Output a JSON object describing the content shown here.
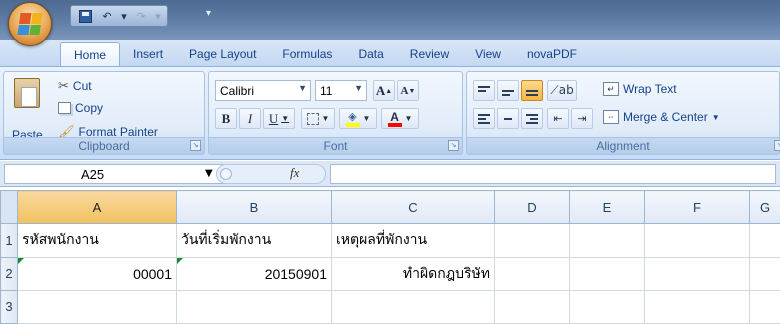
{
  "qat": {
    "undo_arrow": "▾",
    "redo_arrow": "▾",
    "customize_arrow": "▾"
  },
  "tabs": [
    {
      "label": "Home",
      "active": true
    },
    {
      "label": "Insert",
      "active": false
    },
    {
      "label": "Page Layout",
      "active": false
    },
    {
      "label": "Formulas",
      "active": false
    },
    {
      "label": "Data",
      "active": false
    },
    {
      "label": "Review",
      "active": false
    },
    {
      "label": "View",
      "active": false
    },
    {
      "label": "novaPDF",
      "active": false
    }
  ],
  "clipboard": {
    "paste": "Paste",
    "cut": "Cut",
    "copy": "Copy",
    "format_painter": "Format Painter",
    "group_label": "Clipboard"
  },
  "font": {
    "font_name": "Calibri",
    "font_size": "11",
    "grow": "A",
    "shrink": "A",
    "bold": "B",
    "italic": "I",
    "underline": "U",
    "group_label": "Font",
    "fill_color": "#ffff00",
    "font_color": "#ff0000"
  },
  "alignment": {
    "wrap_text": "Wrap Text",
    "merge_center": "Merge & Center",
    "group_label": "Alignment"
  },
  "formula_bar": {
    "name_box": "A25",
    "fx": "fx",
    "formula": ""
  },
  "sheet": {
    "columns": [
      "A",
      "B",
      "C",
      "D",
      "E",
      "F",
      "G"
    ],
    "selected_column": "A",
    "rows": [
      {
        "num": "1",
        "cells": [
          "รหัสพนักงาน",
          "วันที่เริ่มพักงาน",
          "เหตุผลที่พักงาน",
          "",
          "",
          "",
          ""
        ]
      },
      {
        "num": "2",
        "cells": [
          "00001",
          "20150901",
          "ทำผิดกฎบริษัท",
          "",
          "",
          "",
          ""
        ]
      },
      {
        "num": "3",
        "cells": [
          "",
          "",
          "",
          "",
          "",
          "",
          ""
        ]
      }
    ]
  },
  "colors": {
    "ribbon_blue": "#dbe8f8",
    "selection_orange": "#f1c15f",
    "text_blue": "#15428b"
  }
}
